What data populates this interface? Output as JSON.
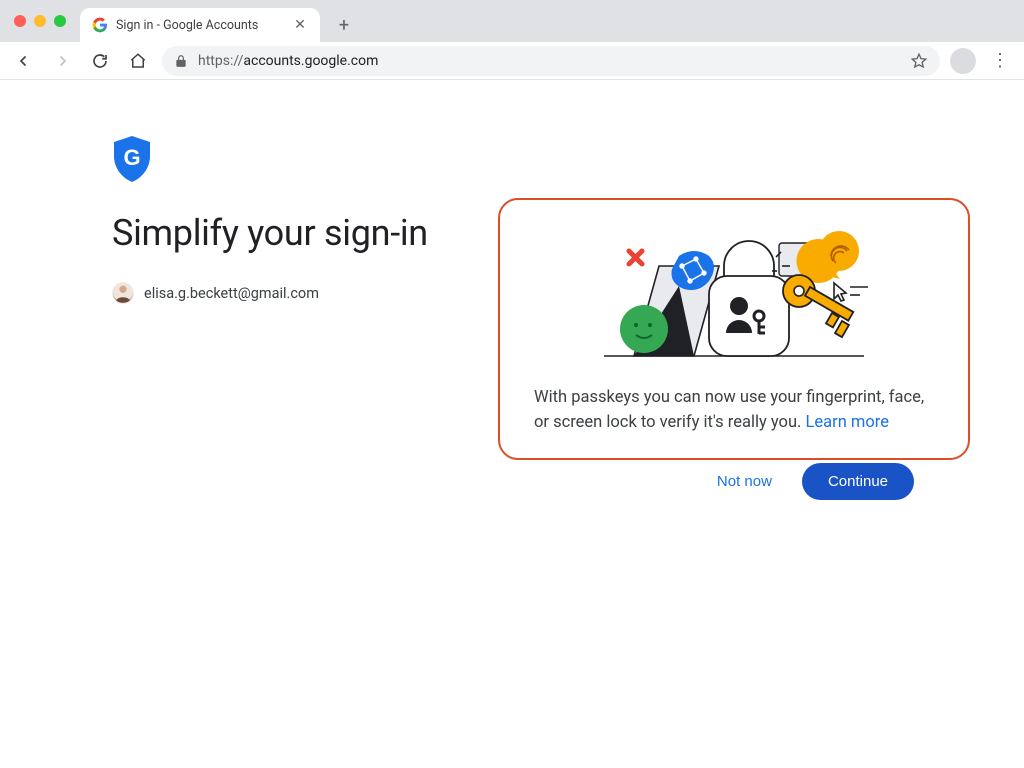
{
  "browser": {
    "tab_title": "Sign in - Google Accounts",
    "url_scheme": "https://",
    "url_host": "accounts.google.com"
  },
  "page": {
    "headline": "Simplify your sign-in",
    "account_email": "elisa.g.beckett@gmail.com"
  },
  "card": {
    "body_text": "With passkeys you can now use your fingerprint, face, or screen lock to verify it's really you. ",
    "learn_more_label": "Learn more"
  },
  "actions": {
    "not_now_label": "Not now",
    "continue_label": "Continue"
  },
  "colors": {
    "accent_blue": "#1a73e8",
    "primary_button": "#1a53c6",
    "highlight_border": "#d94f26"
  }
}
